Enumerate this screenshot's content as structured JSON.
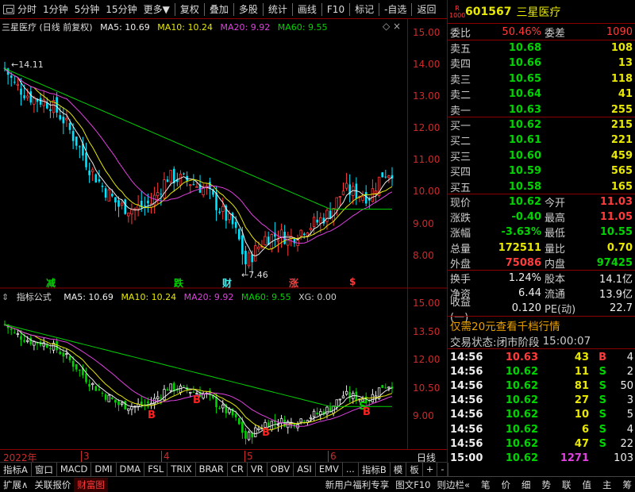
{
  "toolbar": {
    "items": [
      "分时",
      "1分钟",
      "5分钟",
      "15分钟",
      "更多",
      "复权",
      "叠加",
      "多股",
      "统计",
      "画线",
      "F10",
      "标记",
      "-自选",
      "返回"
    ]
  },
  "main_legend": {
    "title": "三星医疗 (日线 前复权)",
    "ma5": "MA5: 10.69",
    "ma10": "MA10: 10.24",
    "ma20": "MA20: 9.92",
    "ma60": "MA60: 9.55"
  },
  "sub_legend": {
    "title": "指标公式",
    "ma5": "MA5: 10.69",
    "ma10": "MA10: 10.24",
    "ma20": "MA20: 9.92",
    "ma60": "MA60: 9.55",
    "xg": "XG: 0.00"
  },
  "main_axis": [
    "15.00",
    "14.00",
    "13.00",
    "12.00",
    "11.00",
    "10.00",
    "9.00",
    "8.00"
  ],
  "sub_axis": [
    "15.00",
    "13.50",
    "12.00",
    "10.50",
    "9.00"
  ],
  "annotations": {
    "high": "14.11",
    "low": "7.46"
  },
  "markers_main": [
    {
      "t": "减",
      "c": "#00d400"
    },
    {
      "t": "跌",
      "c": "#00d400"
    },
    {
      "t": "财",
      "c": "#4ee"
    },
    {
      "t": "涨",
      "c": "#ff3b3b"
    },
    {
      "t": "$",
      "c": "#ff3b3b"
    }
  ],
  "signals_sub": [
    {
      "t": "B",
      "c": "#ff2020"
    },
    {
      "t": "B",
      "c": "#ff2020"
    },
    {
      "t": "B",
      "c": "#ff2020"
    },
    {
      "t": "S",
      "c": "#00d400"
    },
    {
      "t": "B",
      "c": "#ff2020"
    }
  ],
  "xaxis": {
    "year": "2022年",
    "m3": "3",
    "m4": "4",
    "m5": "5",
    "m6": "6",
    "right": "日线"
  },
  "ind_tabs": [
    "指标A",
    "窗口",
    "MACD",
    "DMI",
    "DMA",
    "FSL",
    "TRIX",
    "BRAR",
    "CR",
    "VR",
    "OBV",
    "ASI",
    "EMV",
    "...",
    "指标B",
    "模",
    "板",
    "+",
    "-"
  ],
  "bottom_tabs": [
    "扩展∧",
    "关联报价",
    "财富图",
    "新用户福利专享",
    "图文F10",
    "则边栏«",
    "笔",
    "价",
    "细",
    "势",
    "联",
    "值",
    "主",
    "筹"
  ],
  "stock": {
    "code": "601567",
    "name": "三星医疗",
    "badge_top": "R",
    "badge_bot": "1000"
  },
  "weibi": {
    "l1": "委比",
    "v1": "50.46%",
    "l2": "委差",
    "v2": "1090"
  },
  "asks": [
    {
      "l": "卖五",
      "p": "10.68",
      "v": "108"
    },
    {
      "l": "卖四",
      "p": "10.66",
      "v": "13"
    },
    {
      "l": "卖三",
      "p": "10.65",
      "v": "118"
    },
    {
      "l": "卖二",
      "p": "10.64",
      "v": "41"
    },
    {
      "l": "卖一",
      "p": "10.63",
      "v": "255"
    }
  ],
  "bids": [
    {
      "l": "买一",
      "p": "10.62",
      "v": "215"
    },
    {
      "l": "买二",
      "p": "10.61",
      "v": "221"
    },
    {
      "l": "买三",
      "p": "10.60",
      "v": "459"
    },
    {
      "l": "买四",
      "p": "10.59",
      "v": "565"
    },
    {
      "l": "买五",
      "p": "10.58",
      "v": "165"
    }
  ],
  "quote": [
    {
      "l1": "现价",
      "v1": "10.62",
      "c1": "green",
      "l2": "今开",
      "v2": "11.03",
      "c2": "red"
    },
    {
      "l1": "涨跌",
      "v1": "-0.40",
      "c1": "green",
      "l2": "最高",
      "v2": "11.05",
      "c2": "red"
    },
    {
      "l1": "涨幅",
      "v1": "-3.63%",
      "c1": "green",
      "l2": "最低",
      "v2": "10.55",
      "c2": "green"
    },
    {
      "l1": "总量",
      "v1": "172511",
      "c1": "yel",
      "l2": "量比",
      "v2": "0.70",
      "c2": "yel"
    },
    {
      "l1": "外盘",
      "v1": "75086",
      "c1": "red",
      "l2": "内盘",
      "v2": "97425",
      "c2": "green"
    }
  ],
  "stats": [
    {
      "l1": "换手",
      "v1": "1.24%",
      "l2": "股本",
      "v2": "14.1亿"
    },
    {
      "l1": "净资",
      "v1": "6.44",
      "l2": "流通",
      "v2": "13.9亿"
    },
    {
      "l1": "收益(一)",
      "v1": "0.120",
      "l2": "PE(动)",
      "v2": "22.7"
    }
  ],
  "promo": "仅需20元查看千档行情",
  "status": {
    "label": "交易状态:",
    "v1": "闭市阶段",
    "v2": "15:00:07"
  },
  "ticks": [
    {
      "t": "14:56",
      "p": "10.63",
      "pc": "red",
      "v": "43",
      "vc": "yel",
      "d": "B",
      "dc": "red",
      "n": "4"
    },
    {
      "t": "14:56",
      "p": "10.62",
      "pc": "green",
      "v": "11",
      "vc": "yel",
      "d": "S",
      "dc": "green",
      "n": "2"
    },
    {
      "t": "14:56",
      "p": "10.62",
      "pc": "green",
      "v": "81",
      "vc": "yel",
      "d": "S",
      "dc": "green",
      "n": "50"
    },
    {
      "t": "14:56",
      "p": "10.62",
      "pc": "green",
      "v": "27",
      "vc": "yel",
      "d": "S",
      "dc": "green",
      "n": "3"
    },
    {
      "t": "14:56",
      "p": "10.62",
      "pc": "green",
      "v": "10",
      "vc": "yel",
      "d": "S",
      "dc": "green",
      "n": "5"
    },
    {
      "t": "14:56",
      "p": "10.62",
      "pc": "green",
      "v": "6",
      "vc": "yel",
      "d": "S",
      "dc": "green",
      "n": "4"
    },
    {
      "t": "14:56",
      "p": "10.62",
      "pc": "green",
      "v": "47",
      "vc": "yel",
      "d": "S",
      "dc": "green",
      "n": "22"
    },
    {
      "t": "15:00",
      "p": "10.62",
      "pc": "green",
      "v": "1271",
      "vc": "mag",
      "d": "",
      "dc": "wht",
      "n": "103"
    }
  ]
}
